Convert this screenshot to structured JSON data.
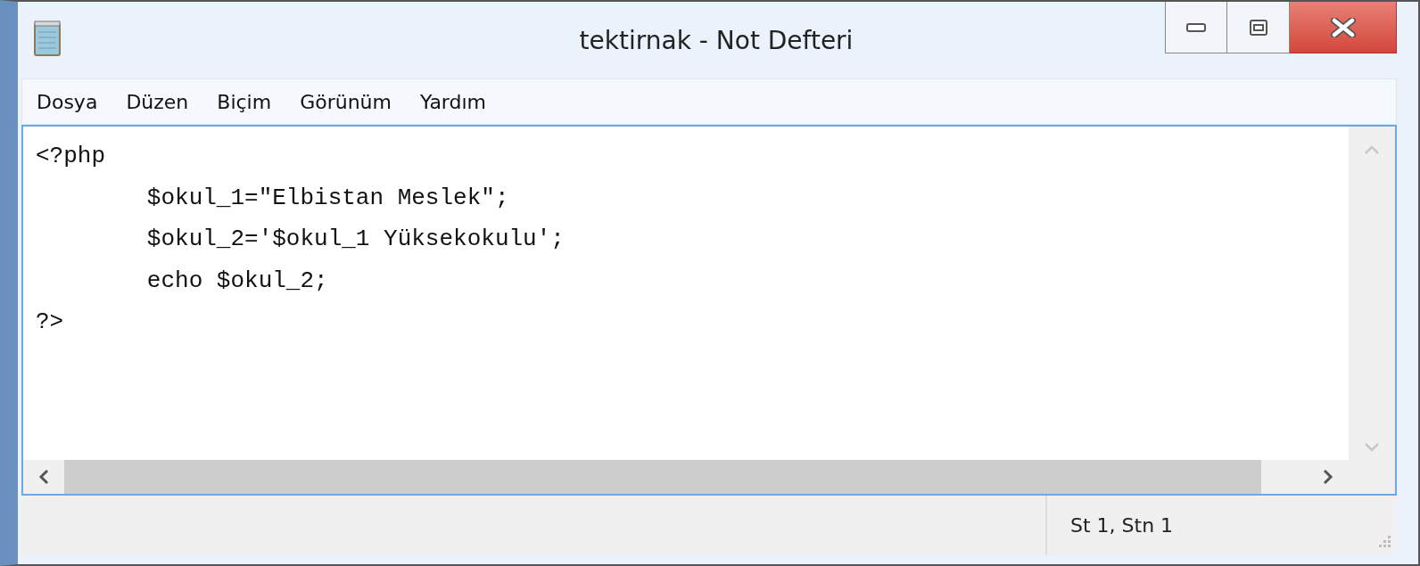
{
  "window": {
    "title": "tektirnak - Not Defteri"
  },
  "menu": [
    {
      "label": "Dosya"
    },
    {
      "label": "Düzen"
    },
    {
      "label": "Biçim"
    },
    {
      "label": "Görünüm"
    },
    {
      "label": "Yardım"
    }
  ],
  "editor": {
    "lines": [
      "<?php",
      "        $okul_1=\"Elbistan Meslek\";",
      "        $okul_2='$okul_1 Yüksekokulu';",
      "        echo $okul_2;",
      "?>"
    ]
  },
  "status_bar": {
    "position": "St 1, Stn 1"
  }
}
